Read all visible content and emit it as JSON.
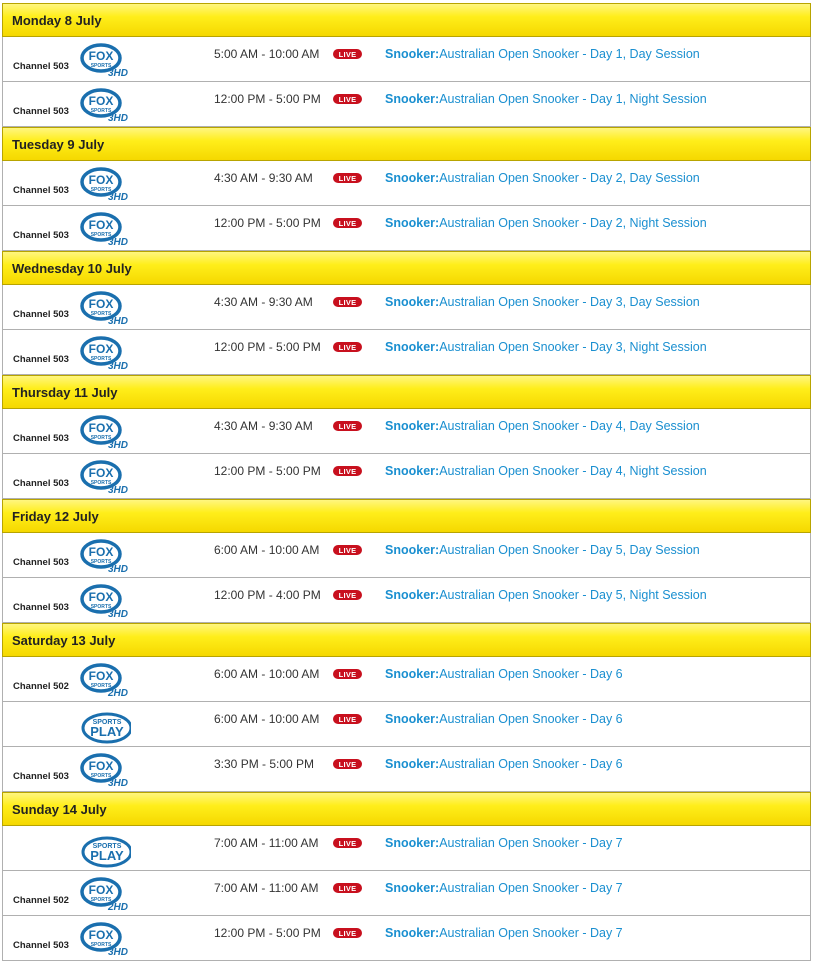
{
  "days": [
    {
      "label": "Monday 8 July",
      "rows": [
        {
          "channel": "Channel 503",
          "logo": "fox-sports-3hd",
          "time": "5:00 AM - 10:00 AM",
          "badge": "LIVE",
          "category": "Snooker:",
          "title": "Australian Open Snooker - Day 1, Day Session"
        },
        {
          "channel": "Channel 503",
          "logo": "fox-sports-3hd",
          "time": "12:00 PM - 5:00 PM",
          "badge": "LIVE",
          "category": "Snooker:",
          "title": "Australian Open Snooker - Day 1, Night Session"
        }
      ]
    },
    {
      "label": "Tuesday 9 July",
      "rows": [
        {
          "channel": "Channel 503",
          "logo": "fox-sports-3hd",
          "time": "4:30 AM - 9:30 AM",
          "badge": "LIVE",
          "category": "Snooker:",
          "title": "Australian Open Snooker - Day 2, Day Session"
        },
        {
          "channel": "Channel 503",
          "logo": "fox-sports-3hd",
          "time": "12:00 PM - 5:00 PM",
          "badge": "LIVE",
          "category": "Snooker:",
          "title": "Australian Open Snooker - Day 2, Night Session"
        }
      ]
    },
    {
      "label": "Wednesday 10 July",
      "rows": [
        {
          "channel": "Channel 503",
          "logo": "fox-sports-3hd",
          "time": "4:30 AM - 9:30 AM",
          "badge": "LIVE",
          "category": "Snooker:",
          "title": "Australian Open Snooker - Day 3, Day Session"
        },
        {
          "channel": "Channel 503",
          "logo": "fox-sports-3hd",
          "time": "12:00 PM - 5:00 PM",
          "badge": "LIVE",
          "category": "Snooker:",
          "title": "Australian Open Snooker - Day 3, Night Session"
        }
      ]
    },
    {
      "label": "Thursday 11 July",
      "rows": [
        {
          "channel": "Channel 503",
          "logo": "fox-sports-3hd",
          "time": "4:30 AM - 9:30 AM",
          "badge": "LIVE",
          "category": "Snooker:",
          "title": "Australian Open Snooker - Day 4, Day Session"
        },
        {
          "channel": "Channel 503",
          "logo": "fox-sports-3hd",
          "time": "12:00 PM - 5:00 PM",
          "badge": "LIVE",
          "category": "Snooker:",
          "title": "Australian Open Snooker - Day 4, Night Session"
        }
      ]
    },
    {
      "label": "Friday 12 July",
      "rows": [
        {
          "channel": "Channel 503",
          "logo": "fox-sports-3hd",
          "time": "6:00 AM - 10:00 AM",
          "badge": "LIVE",
          "category": "Snooker:",
          "title": "Australian Open Snooker - Day 5, Day Session"
        },
        {
          "channel": "Channel 503",
          "logo": "fox-sports-3hd",
          "time": "12:00 PM - 4:00 PM",
          "badge": "LIVE",
          "category": "Snooker:",
          "title": "Australian Open Snooker - Day 5, Night Session"
        }
      ]
    },
    {
      "label": "Saturday 13 July",
      "rows": [
        {
          "channel": "Channel 502",
          "logo": "fox-sports-2hd",
          "time": "6:00 AM - 10:00 AM",
          "badge": "LIVE",
          "category": "Snooker:",
          "title": "Australian Open Snooker - Day 6"
        },
        {
          "channel": "",
          "logo": "sports-play",
          "time": "6:00 AM - 10:00 AM",
          "badge": "LIVE",
          "category": "Snooker:",
          "title": "Australian Open Snooker - Day 6"
        },
        {
          "channel": "Channel 503",
          "logo": "fox-sports-3hd",
          "time": "3:30 PM - 5:00 PM",
          "badge": "LIVE",
          "category": "Snooker:",
          "title": "Australian Open Snooker - Day 6"
        }
      ]
    },
    {
      "label": "Sunday 14 July",
      "rows": [
        {
          "channel": "",
          "logo": "sports-play",
          "time": "7:00 AM - 11:00 AM",
          "badge": "LIVE",
          "category": "Snooker:",
          "title": "Australian Open Snooker - Day 7"
        },
        {
          "channel": "Channel 502",
          "logo": "fox-sports-2hd",
          "time": "7:00 AM - 11:00 AM",
          "badge": "LIVE",
          "category": "Snooker:",
          "title": "Australian Open Snooker - Day 7"
        },
        {
          "channel": "Channel 503",
          "logo": "fox-sports-3hd",
          "time": "12:00 PM - 5:00 PM",
          "badge": "LIVE",
          "category": "Snooker:",
          "title": "Australian Open Snooker - Day 7"
        }
      ]
    }
  ],
  "logos": {
    "fox-sports-3hd": {
      "brand": "FOX",
      "sub": "SPORTS",
      "suffix": "3HD"
    },
    "fox-sports-2hd": {
      "brand": "FOX",
      "sub": "SPORTS",
      "suffix": "2HD"
    },
    "sports-play": {
      "top": "SPORTS",
      "main": "PLAY"
    }
  },
  "colors": {
    "link": "#1a8fd0",
    "live": "#c8101e",
    "header": "#ffee1a",
    "logo": "#1a6fae"
  }
}
